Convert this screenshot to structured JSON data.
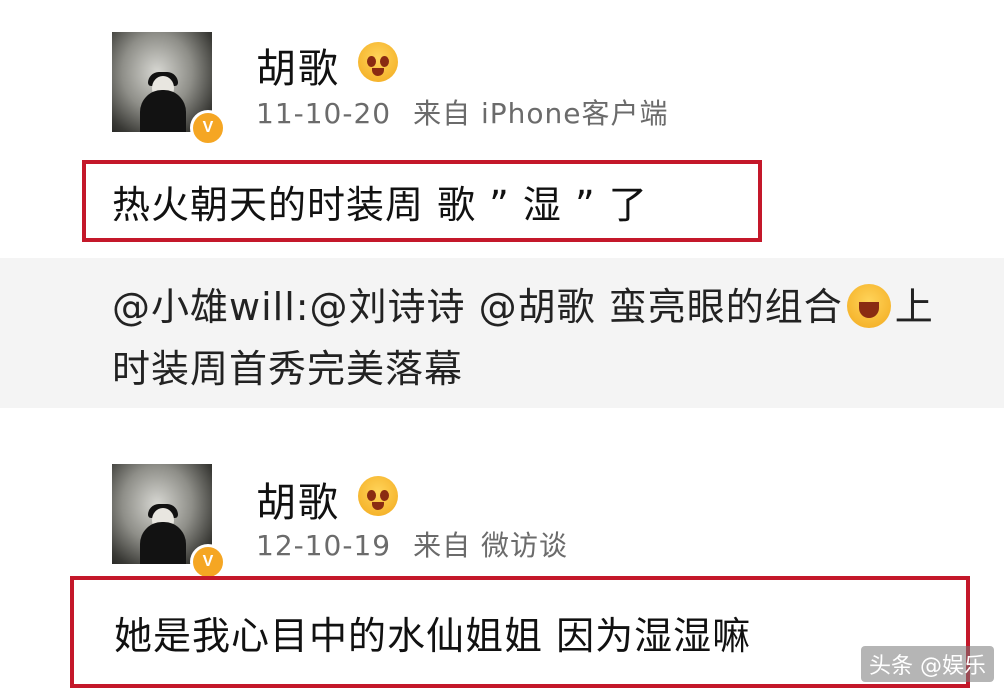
{
  "posts": [
    {
      "username": "胡歌",
      "date": "11-10-20",
      "source": "来自 iPhone客户端",
      "content": "热火朝天的时装周 歌 ” 湿 ” 了",
      "verified_badge": "V",
      "emoji_icon": "sad-face-emoji"
    },
    {
      "username": "胡歌",
      "date": "12-10-19",
      "source": "来自 微访谈",
      "content": "她是我心目中的水仙姐姐 因为湿湿嘛",
      "verified_badge": "V",
      "emoji_icon": "sad-face-emoji"
    }
  ],
  "repost": {
    "line1": "@小雄will:@刘诗诗 @胡歌 蛮亮眼的组合",
    "line1_tail": "上",
    "line2": "时装周首秀完美落幕"
  },
  "watermark": "头条 @娱乐",
  "colors": {
    "highlight_border": "#c4182a",
    "verified": "#f5a623",
    "repost_bg": "#f4f4f4"
  }
}
